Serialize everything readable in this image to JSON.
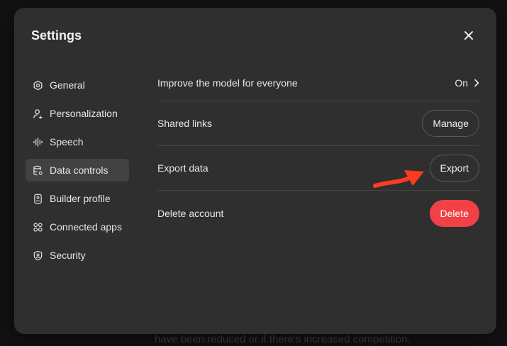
{
  "modal": {
    "title": "Settings",
    "close_icon": "close-icon"
  },
  "sidebar": {
    "items": [
      {
        "label": "General",
        "icon": "gear-icon",
        "active": false
      },
      {
        "label": "Personalization",
        "icon": "person-icon",
        "active": false
      },
      {
        "label": "Speech",
        "icon": "waveform-icon",
        "active": false
      },
      {
        "label": "Data controls",
        "icon": "database-icon",
        "active": true
      },
      {
        "label": "Builder profile",
        "icon": "id-card-icon",
        "active": false
      },
      {
        "label": "Connected apps",
        "icon": "apps-grid-icon",
        "active": false
      },
      {
        "label": "Security",
        "icon": "shield-icon",
        "active": false
      }
    ]
  },
  "content": {
    "rows": [
      {
        "label": "Improve the model for everyone",
        "value": "On"
      },
      {
        "label": "Shared links",
        "button": "Manage"
      },
      {
        "label": "Export data",
        "button": "Export"
      },
      {
        "label": "Delete account",
        "button": "Delete"
      }
    ]
  },
  "annotation": {
    "arrow_color": "#ff3b1f"
  },
  "background": {
    "bottom_text": "have been reduced or if there's increased competition."
  },
  "colors": {
    "modal_bg": "#2f2f2f",
    "active_item": "#424242",
    "danger": "#ef4146"
  }
}
